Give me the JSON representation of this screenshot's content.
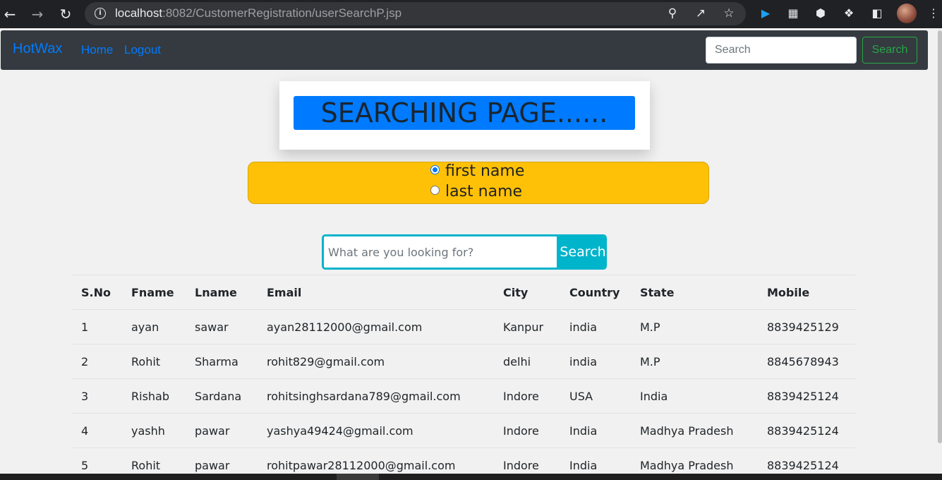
{
  "browser": {
    "url_host": "localhost",
    "url_rest": ":8082/CustomerRegistration/userSearchP.jsp"
  },
  "navbar": {
    "brand": "HotWax",
    "links": [
      "Home",
      "Logout"
    ],
    "search_placeholder": "Search",
    "search_button": "Search"
  },
  "heading": "SEARCHING PAGE......",
  "radio_options": [
    {
      "label": "first name",
      "checked": true
    },
    {
      "label": "last name",
      "checked": false
    }
  ],
  "search": {
    "placeholder": "What are you looking for?",
    "button": "Search"
  },
  "table": {
    "columns": [
      "S.No",
      "Fname",
      "Lname",
      "Email",
      "City",
      "Country",
      "State",
      "Mobile"
    ],
    "rows": [
      [
        "1",
        "ayan",
        "sawar",
        "ayan28112000@gmail.com",
        "Kanpur",
        "india",
        "M.P",
        "8839425129"
      ],
      [
        "2",
        "Rohit",
        "Sharma",
        "rohit829@gmail.com",
        "delhi",
        "india",
        "M.P",
        "8845678943"
      ],
      [
        "3",
        "Rishab",
        "Sardana",
        "rohitsinghsardana789@gmail.com",
        "Indore",
        "USA",
        "India",
        "8839425124"
      ],
      [
        "4",
        "yashh",
        "pawar",
        "yashya49424@gmail.com",
        "Indore",
        "India",
        "Madhya Pradesh",
        "8839425124"
      ],
      [
        "5",
        "Rohit",
        "pawar",
        "rohitpawar28112000@gmail.com",
        "Indore",
        "India",
        "Madhya Pradesh",
        "8839425124"
      ]
    ]
  },
  "colors": {
    "primary": "#007bff",
    "warning": "#ffc107",
    "success": "#28a745",
    "accent": "#00b4cc",
    "navbar": "#343a40"
  }
}
